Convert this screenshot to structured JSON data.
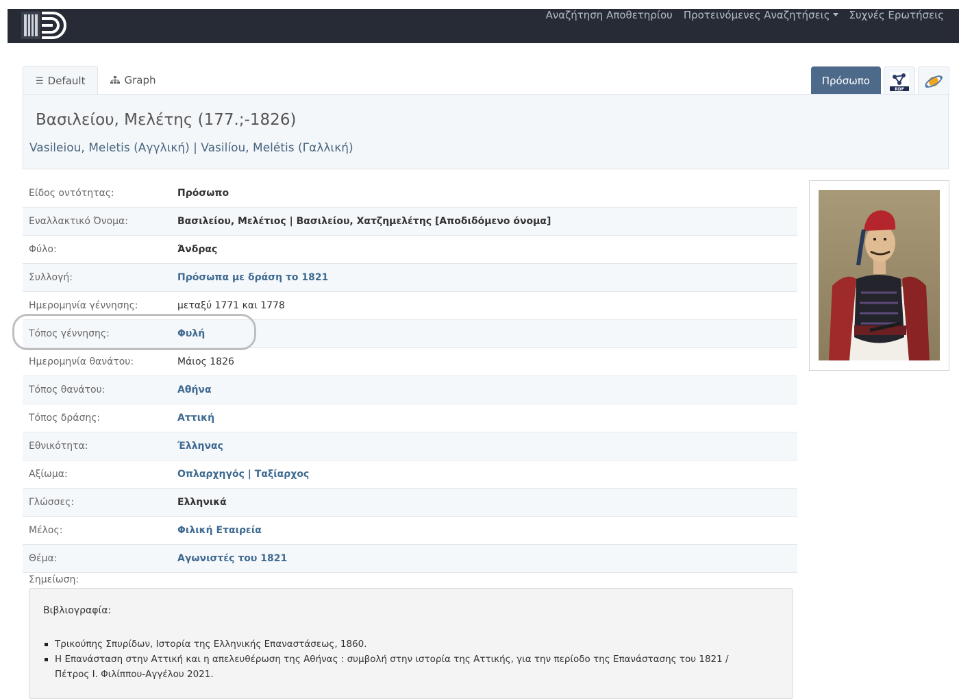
{
  "nav": {
    "items": [
      "Αναζήτηση Αποθετηρίου",
      "Προτεινόμενες Αναζητήσεις",
      "Συχνές Ερωτήσεις"
    ],
    "dropdown_index": 1
  },
  "tabs": [
    {
      "label": "Default",
      "icon": "list-icon"
    },
    {
      "label": "Graph",
      "icon": "sitemap-icon"
    }
  ],
  "entity_type_button": "Πρόσωπο",
  "title": "Βασιλείου, Μελέτης (177.;-1826)",
  "subtitle": "Vasileiou, Meletis (Αγγλική) | Vasilíou, Melétis (Γαλλική)",
  "properties": [
    {
      "label": "Είδος οντότητας:",
      "value": "Πρόσωπο",
      "style": "bold"
    },
    {
      "label": "Εναλλακτικό Όνομα:",
      "value": "Βασιλείου, Μελέτιος | Βασιλείου, Χατζημελέτης [Αποδιδόμενο όνομα]",
      "style": "bold"
    },
    {
      "label": "Φύλο:",
      "value": "Άνδρας",
      "style": "bold"
    },
    {
      "label": "Συλλογή:",
      "value": "Πρόσωπα με δράση το 1821",
      "style": "link"
    },
    {
      "label": "Ημερομηνία γέννησης:",
      "value": "μεταξύ 1771 και 1778",
      "style": "plain"
    },
    {
      "label": "Τόπος γέννησης:",
      "value": "Φυλή",
      "style": "link"
    },
    {
      "label": "Ημερομηνία θανάτου:",
      "value": "Μάιος 1826",
      "style": "plain"
    },
    {
      "label": "Τόπος θανάτου:",
      "value": "Αθήνα",
      "style": "link"
    },
    {
      "label": "Τόπος δράσης:",
      "value": "Αττική",
      "style": "link"
    },
    {
      "label": "Εθνικότητα:",
      "value": "Έλληνας",
      "style": "link"
    },
    {
      "label": "Αξίωμα:",
      "value": "Οπλαρχηγός | Ταξίαρχος",
      "style": "link"
    },
    {
      "label": "Γλώσσες:",
      "value": "Ελληνικά",
      "style": "bold"
    },
    {
      "label": "Μέλος:",
      "value": "Φιλική Εταιρεία",
      "style": "link"
    },
    {
      "label": "Θέμα:",
      "value": "Αγωνιστές του 1821",
      "style": "link"
    }
  ],
  "note": {
    "label": "Σημείωση:",
    "heading": "Βιβλιογραφία:",
    "items": [
      "Τρικούπης Σπυρίδων, Ιστορία της Ελληνικής Επαναστάσεως, 1860.",
      "Η Επανάσταση στην Αττική και η απελευθέρωση της Αθήνας : συμβολή στην ιστορία της Αττικής, για την περίοδο της Επανάστασης του 1821 /",
      "Πέτρος Ι. Φιλίππου-Αγγέλου 2021."
    ]
  }
}
